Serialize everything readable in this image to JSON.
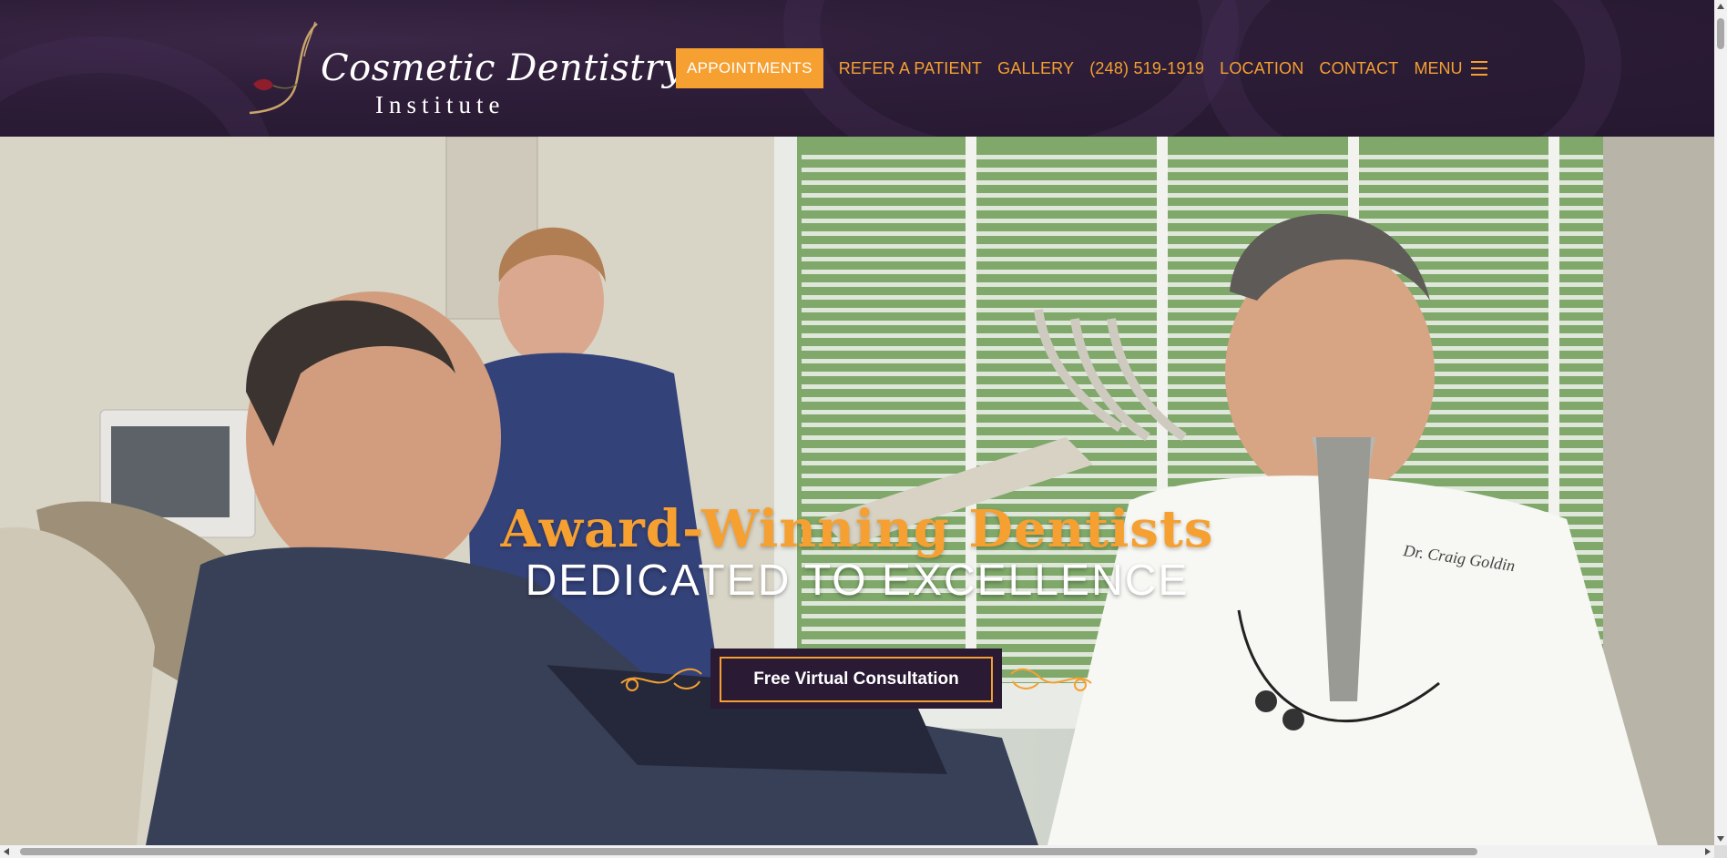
{
  "brand": {
    "name_script": "Cosmetic Dentistry",
    "name_sub": "Institute",
    "logo_icon": "rose-tooth-logo-icon"
  },
  "nav": {
    "appointments": "APPOINTMENTS",
    "refer": "REFER A PATIENT",
    "gallery": "GALLERY",
    "phone": "(248) 519-1919",
    "location": "LOCATION",
    "contact": "CONTACT",
    "menu": "MENU",
    "menu_icon": "hamburger-icon"
  },
  "hero": {
    "headline": "Award-Winning Dentists",
    "subheadline": "DEDICATED TO EXCELLENCE",
    "cta": "Free Virtual Consultation",
    "image": "dentist-office-photo",
    "coat_text": "Dr. Craig Goldin"
  },
  "colors": {
    "header_bg": "#2d1d38",
    "accent": "#f5a031",
    "cta_bg": "#2a1a33",
    "text_light": "#ffffff"
  }
}
